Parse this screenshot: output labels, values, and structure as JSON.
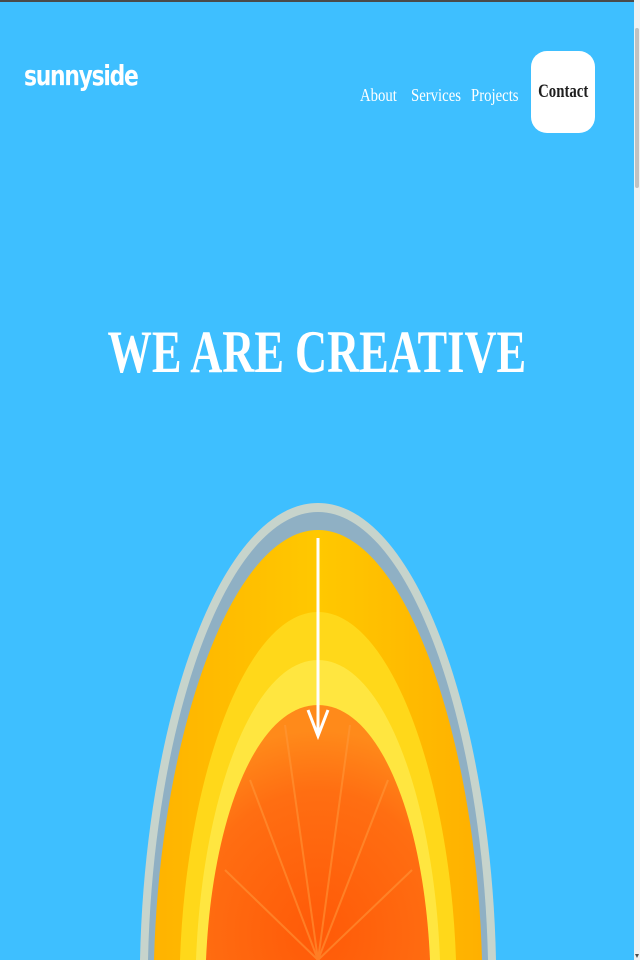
{
  "header": {
    "logo": "sunnyside",
    "nav": {
      "about": "About",
      "services": "Services",
      "projects": "Projects",
      "contact": "Contact"
    }
  },
  "hero": {
    "title": "WE ARE CREATIVE"
  },
  "colors": {
    "background": "#3ebfff",
    "text": "#ffffff",
    "button_bg": "#ffffff",
    "button_text": "#1f1f1f",
    "orange_rind": "#ffc400",
    "orange_pith": "#ffe23a",
    "orange_flesh": "#ff6a10"
  },
  "icons": {
    "scroll_indicator": "arrow-down-icon",
    "hero_image": "orange-slice-image"
  }
}
